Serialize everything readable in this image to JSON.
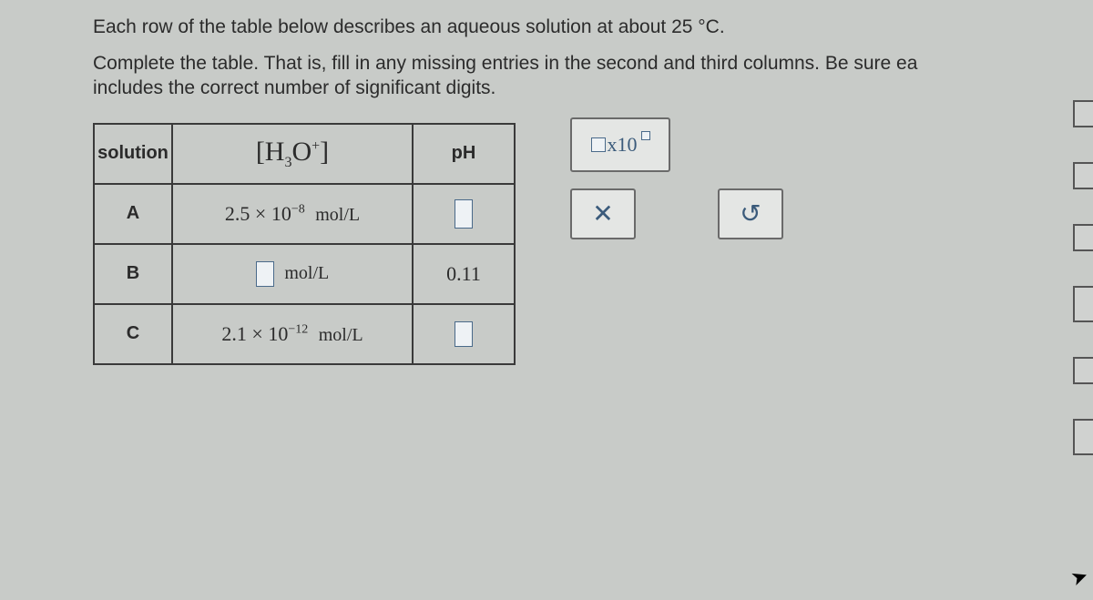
{
  "instructions": {
    "line1": "Each row of the table below describes an aqueous solution at about 25 °C.",
    "line2": "Complete the table. That is, fill in any missing entries in the second and third columns. Be sure ea",
    "line3": "includes the correct number of significant digits."
  },
  "table": {
    "headers": {
      "solution": "solution",
      "h3o": "[H₃O⁺]",
      "ph": "pH"
    },
    "rows": {
      "A": {
        "label": "A",
        "h3o_coeff": "2.5",
        "h3o_times": "×",
        "h3o_base": "10",
        "h3o_exp": "−8",
        "h3o_unit": "mol/L",
        "ph": ""
      },
      "B": {
        "label": "B",
        "h3o_unit": "mol/L",
        "ph": "0.11"
      },
      "C": {
        "label": "C",
        "h3o_coeff": "2.1",
        "h3o_times": "×",
        "h3o_base": "10",
        "h3o_exp": "−12",
        "h3o_unit": "mol/L",
        "ph": ""
      }
    }
  },
  "palette": {
    "sci_label": "x10",
    "clear": "✕",
    "reset": "↺"
  }
}
